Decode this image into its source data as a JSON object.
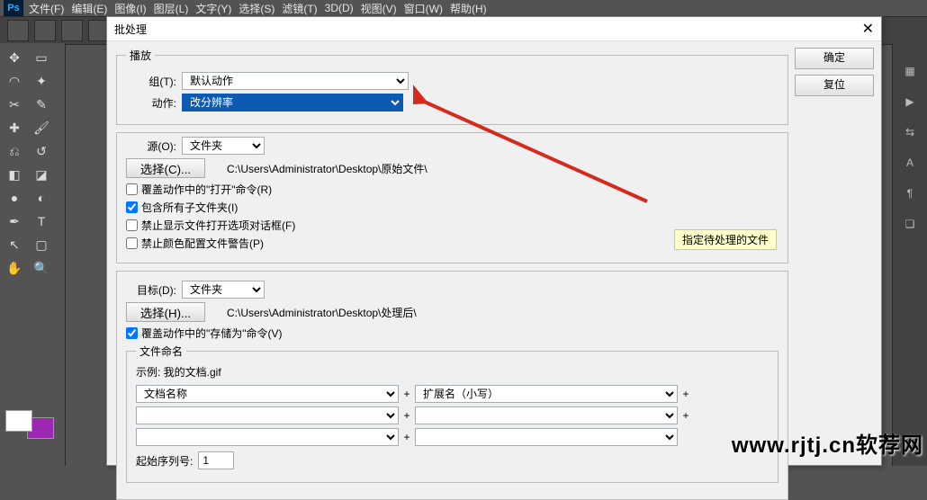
{
  "menubar": {
    "items": [
      "文件(F)",
      "编辑(E)",
      "图像(I)",
      "图层(L)",
      "文字(Y)",
      "选择(S)",
      "滤镜(T)",
      "3D(D)",
      "视图(V)",
      "窗口(W)",
      "帮助(H)"
    ]
  },
  "dialog": {
    "title": "批处理",
    "close": "✕",
    "ok": "确定",
    "reset": "复位",
    "playback": {
      "legend": "播放",
      "group_label": "组(T):",
      "group_value": "默认动作",
      "action_label": "动作:",
      "action_value": "改分辨率"
    },
    "source": {
      "src_label": "源(O):",
      "src_value": "文件夹",
      "choose": "选择(C)...",
      "path": "C:\\Users\\Administrator\\Desktop\\原始文件\\",
      "opt1": "覆盖动作中的\"打开\"命令(R)",
      "opt2": "包含所有子文件夹(I)",
      "opt3": "禁止显示文件打开选项对话框(F)",
      "opt4": "禁止颜色配置文件警告(P)",
      "hint": "指定待处理的文件"
    },
    "dest": {
      "dst_label": "目标(D):",
      "dst_value": "文件夹",
      "choose": "选择(H)...",
      "path": "C:\\Users\\Administrator\\Desktop\\处理后\\",
      "opt1": "覆盖动作中的\"存储为\"命令(V)",
      "naming_legend": "文件命名",
      "example_label": "示例: 我的文档.gif",
      "name1": "文档名称",
      "name2": "扩展名（小写）",
      "start_label": "起始序列号:",
      "start_value": "1"
    }
  },
  "watermark": "www.rjtj.cn软荐网"
}
